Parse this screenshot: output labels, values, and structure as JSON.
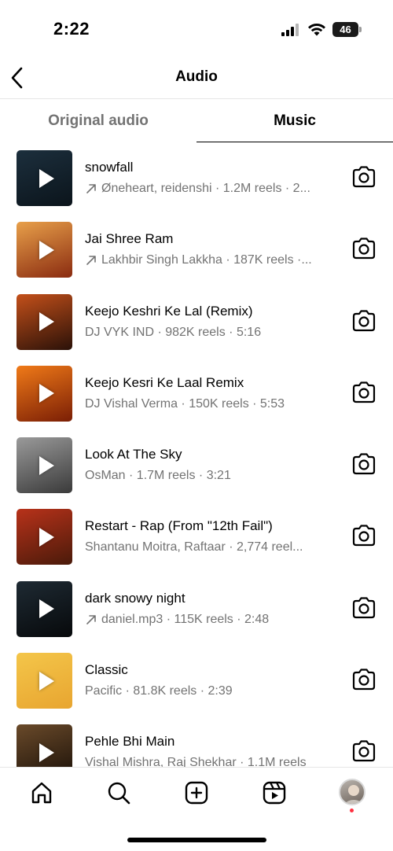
{
  "status_bar": {
    "time": "2:22",
    "battery": "46"
  },
  "header": {
    "title": "Audio"
  },
  "tabs": [
    {
      "label": "Original audio",
      "active": false
    },
    {
      "label": "Music",
      "active": true
    }
  ],
  "tracks": [
    {
      "title": "snowfall",
      "meta": "Øneheart, reidenshi · 1.2M reels · 2...",
      "trending": true,
      "colors": [
        "#1c2f3d",
        "#0b141b"
      ]
    },
    {
      "title": "Jai Shree Ram",
      "meta": "Lakhbir Singh Lakkha · 187K reels ·...",
      "trending": true,
      "colors": [
        "#e8a04a",
        "#8a2b10"
      ]
    },
    {
      "title": "Keejo Keshri Ke Lal (Remix)",
      "meta": "DJ VYK IND · 982K reels · 5:16",
      "trending": false,
      "colors": [
        "#c4501a",
        "#2a1108"
      ]
    },
    {
      "title": "Keejo Kesri Ke Laal Remix",
      "meta": "DJ Vishal Verma · 150K reels · 5:53",
      "trending": false,
      "colors": [
        "#f07a18",
        "#7a1e05"
      ]
    },
    {
      "title": "Look At The Sky",
      "meta": "OsMan · 1.7M reels · 3:21",
      "trending": false,
      "colors": [
        "#9a9a9a",
        "#3a3a3a"
      ]
    },
    {
      "title": "Restart - Rap (From \"12th Fail\")",
      "meta": "Shantanu Moitra, Raftaar · 2,774 reel...",
      "trending": false,
      "colors": [
        "#b8321a",
        "#4a1a0a"
      ]
    },
    {
      "title": "dark snowy night",
      "meta": "daniel.mp3 · 115K reels · 2:48",
      "trending": true,
      "colors": [
        "#1e2a33",
        "#07090b"
      ]
    },
    {
      "title": "Classic",
      "meta": "Pacific · 81.8K reels · 2:39",
      "trending": false,
      "colors": [
        "#f4c64a",
        "#e8a530"
      ]
    },
    {
      "title": "Pehle Bhi Main",
      "meta": "Vishal Mishra, Raj Shekhar · 1.1M reels",
      "trending": false,
      "colors": [
        "#6a4a2a",
        "#1a1008"
      ]
    }
  ]
}
